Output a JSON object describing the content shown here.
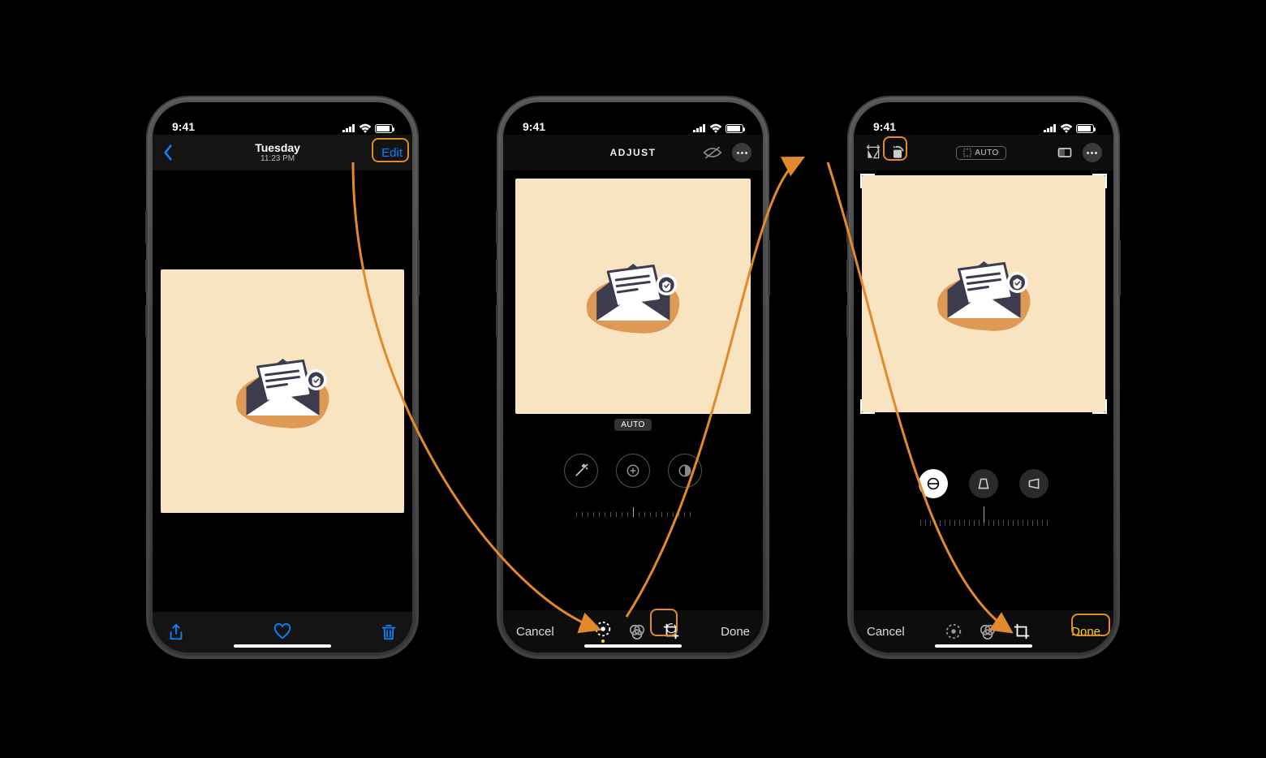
{
  "status": {
    "time": "9:41"
  },
  "phone1": {
    "day": "Tuesday",
    "time": "11:23 PM",
    "edit": "Edit"
  },
  "phone2": {
    "title": "ADJUST",
    "auto": "AUTO",
    "cancel": "Cancel",
    "done": "Done"
  },
  "phone3": {
    "auto": "AUTO",
    "cancel": "Cancel",
    "done": "Done"
  }
}
